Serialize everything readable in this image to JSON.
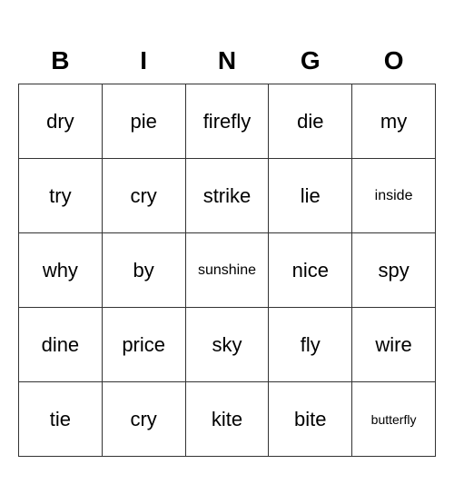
{
  "header": {
    "cols": [
      "B",
      "I",
      "N",
      "G",
      "O"
    ]
  },
  "rows": [
    [
      {
        "text": "dry",
        "small": false
      },
      {
        "text": "pie",
        "small": false
      },
      {
        "text": "firefly",
        "small": false
      },
      {
        "text": "die",
        "small": false
      },
      {
        "text": "my",
        "small": false
      }
    ],
    [
      {
        "text": "try",
        "small": false
      },
      {
        "text": "cry",
        "small": false
      },
      {
        "text": "strike",
        "small": false
      },
      {
        "text": "lie",
        "small": false
      },
      {
        "text": "inside",
        "small": true
      }
    ],
    [
      {
        "text": "why",
        "small": false
      },
      {
        "text": "by",
        "small": false
      },
      {
        "text": "sunshine",
        "small": true
      },
      {
        "text": "nice",
        "small": false
      },
      {
        "text": "spy",
        "small": false
      }
    ],
    [
      {
        "text": "dine",
        "small": false
      },
      {
        "text": "price",
        "small": false
      },
      {
        "text": "sky",
        "small": false
      },
      {
        "text": "fly",
        "small": false
      },
      {
        "text": "wire",
        "small": false
      }
    ],
    [
      {
        "text": "tie",
        "small": false
      },
      {
        "text": "cry",
        "small": false
      },
      {
        "text": "kite",
        "small": false
      },
      {
        "text": "bite",
        "small": false
      },
      {
        "text": "butterfly",
        "small": true
      }
    ]
  ]
}
